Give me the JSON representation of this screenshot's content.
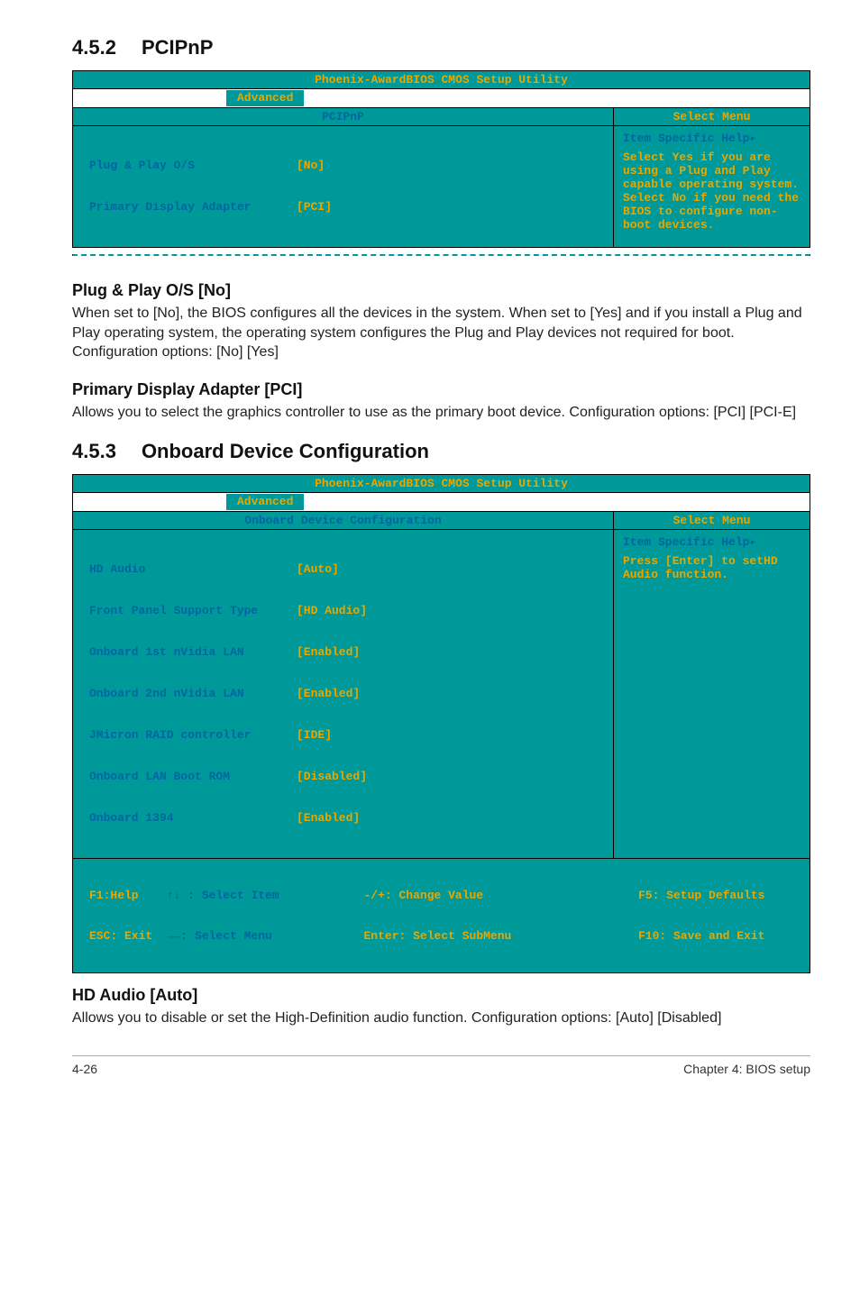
{
  "section_452": {
    "num": "4.5.2",
    "title": "PCIPnP"
  },
  "bios1": {
    "title": "Phoenix-AwardBIOS CMOS Setup Utility",
    "tab": "Advanced",
    "left_header": "PCIPnP",
    "right_header": "Select Menu",
    "rows": [
      {
        "label": "Plug & Play O/S",
        "value": "[No]"
      },
      {
        "label": "Primary Display Adapter",
        "value": "[PCI]"
      }
    ],
    "help_title": "Item Specific Help",
    "help_body": "Select Yes if you are using a Plug and Play capable operating system. Select No if you need the BIOS to configure non-boot devices."
  },
  "sub_pnp": {
    "heading": "Plug & Play O/S [No]",
    "body": "When set to [No], the BIOS configures all the devices in the system. When set to [Yes] and if you install a Plug and Play operating system, the operating system configures the Plug and Play devices not required for boot. Configuration options: [No] [Yes]"
  },
  "sub_pda": {
    "heading": "Primary Display Adapter [PCI]",
    "body": "Allows you to select the graphics controller to use as the primary boot device. Configuration options: [PCI] [PCI-E]"
  },
  "section_453": {
    "num": "4.5.3",
    "title": "Onboard Device Configuration"
  },
  "bios2": {
    "title": "Phoenix-AwardBIOS CMOS Setup Utility",
    "tab": "Advanced",
    "left_header": "Onboard Device Configuration",
    "right_header": "Select Menu",
    "rows": [
      {
        "label": "HD Audio",
        "value": "[Auto]"
      },
      {
        "label": "Front Panel Support Type",
        "value": "[HD Audio]"
      },
      {
        "label": "Onboard 1st nVidia LAN",
        "value": "[Enabled]"
      },
      {
        "label": "Onboard 2nd nVidia LAN",
        "value": "[Enabled]"
      },
      {
        "label": "JMicron RAID controller",
        "value": "[IDE]"
      },
      {
        "label": "Onboard LAN Boot ROM",
        "value": "[Disabled]"
      },
      {
        "label": "Onboard 1394",
        "value": "[Enabled]"
      }
    ],
    "help_title": "Item Specific Help",
    "help_body": "Press [Enter] to setHD Audio function.",
    "footer": {
      "f1": "F1:Help",
      "nav1": "↑↓ : Select Item",
      "change": "-/+: Change Value",
      "f5": "F5: Setup Defaults",
      "esc": "ESC: Exit",
      "nav2": "→←: Select Menu",
      "enter": "Enter: Select SubMenu",
      "f10": "F10: Save and Exit"
    }
  },
  "sub_hd": {
    "heading": "HD Audio [Auto]",
    "body": "Allows you to disable or set the High-Definition audio function. Configuration options: [Auto] [Disabled]"
  },
  "footer": {
    "left": "4-26",
    "right": "Chapter 4: BIOS setup"
  }
}
